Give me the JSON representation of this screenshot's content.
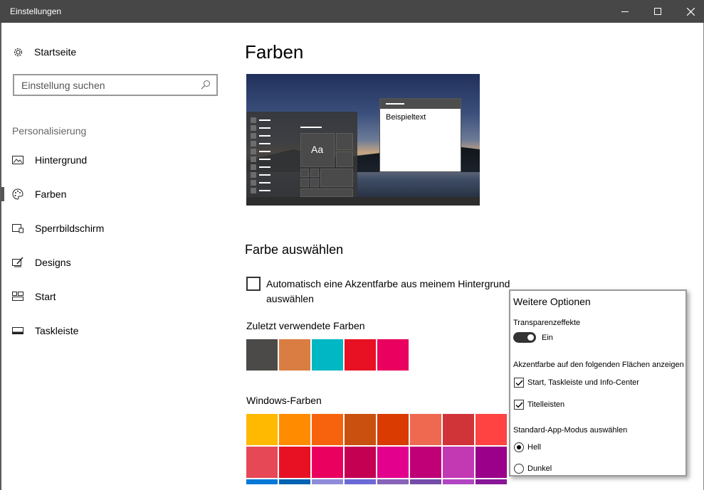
{
  "window": {
    "title": "Einstellungen"
  },
  "sidebar": {
    "home_label": "Startseite",
    "search_placeholder": "Einstellung suchen",
    "section_label": "Personalisierung",
    "items": [
      {
        "label": "Hintergrund",
        "icon": "picture-icon"
      },
      {
        "label": "Farben",
        "icon": "palette-icon",
        "selected": true
      },
      {
        "label": "Sperrbildschirm",
        "icon": "lock-screen-icon"
      },
      {
        "label": "Designs",
        "icon": "brush-icon"
      },
      {
        "label": "Start",
        "icon": "start-tiles-icon"
      },
      {
        "label": "Taskleiste",
        "icon": "taskbar-icon"
      }
    ]
  },
  "main": {
    "title": "Farben",
    "preview": {
      "sample_text": "Beispieltext",
      "tile_text": "Aa"
    },
    "choose_color_heading": "Farbe auswählen",
    "auto_accent_label": "Automatisch eine Akzentfarbe aus meinem Hintergrund auswählen",
    "auto_accent_checked": false,
    "recent_colors_label": "Zuletzt verwendete Farben",
    "recent_colors": [
      "#4c4a48",
      "#da7d42",
      "#00b7c3",
      "#e81123",
      "#ea005e"
    ],
    "windows_colors_label": "Windows-Farben",
    "windows_colors": [
      [
        "#ffb900",
        "#ff8c00",
        "#f7630c",
        "#ca5010",
        "#da3b01",
        "#ef6950",
        "#d13438",
        "#ff4343"
      ],
      [
        "#e74856",
        "#e81123",
        "#ea005e",
        "#c30052",
        "#e3008c",
        "#bf0077",
        "#c239b3",
        "#9a0089"
      ],
      [
        "#0078d7",
        "#0063b1",
        "#8e8cd8",
        "#6b69d6",
        "#8764b8",
        "#744da9",
        "#b146c2",
        "#881798"
      ]
    ]
  },
  "popup": {
    "title": "Weitere Optionen",
    "transparency_label": "Transparenzeffekte",
    "transparency_state": "Ein",
    "accent_surfaces_label": "Akzentfarbe auf den folgenden Flächen anzeigen",
    "surface_options": [
      {
        "label": "Start, Taskleiste und Info-Center",
        "checked": true
      },
      {
        "label": "Titelleisten",
        "checked": true
      }
    ],
    "app_mode_label": "Standard-App-Modus auswählen",
    "app_modes": [
      {
        "label": "Hell",
        "selected": true
      },
      {
        "label": "Dunkel",
        "selected": false
      }
    ]
  }
}
